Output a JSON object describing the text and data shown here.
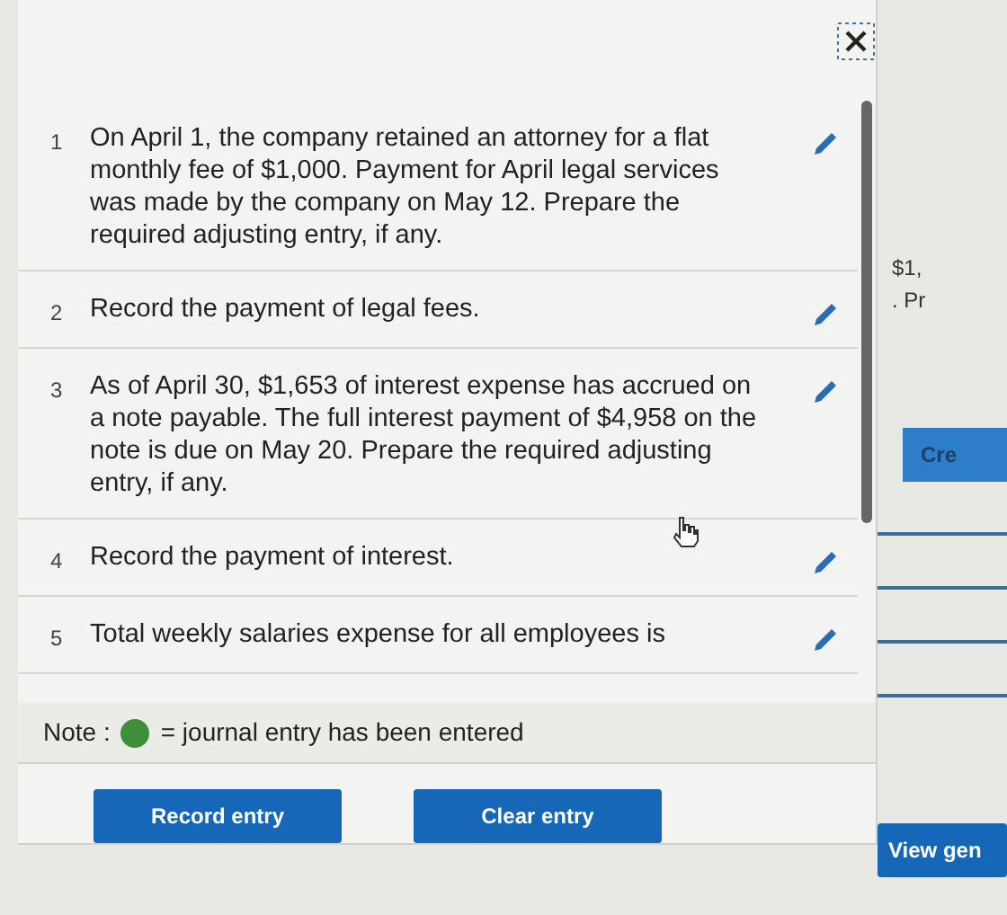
{
  "entries": [
    {
      "number": "1",
      "text": "On April 1, the company retained an attorney for a flat monthly fee of $1,000. Payment for April legal services was made by the company on May 12. Prepare the required adjusting entry, if any."
    },
    {
      "number": "2",
      "text": "Record the payment of legal fees."
    },
    {
      "number": "3",
      "text": "As of April 30, $1,653 of interest expense has accrued on a note payable. The full interest payment of $4,958 on the note is due on May 20. Prepare the required adjusting entry, if any."
    },
    {
      "number": "4",
      "text": "Record the payment of interest."
    },
    {
      "number": "5",
      "text": "Total weekly salaries expense for all employees is"
    }
  ],
  "note": {
    "label": "Note :",
    "color": "#3f8f3a",
    "text": "= journal entry has been entered"
  },
  "buttons": [
    "Record entry",
    "Clear entry"
  ],
  "side_panel": {
    "texts": [
      "$1,",
      ". Pr"
    ],
    "button": "Cre",
    "bottom_button": "View gen"
  }
}
